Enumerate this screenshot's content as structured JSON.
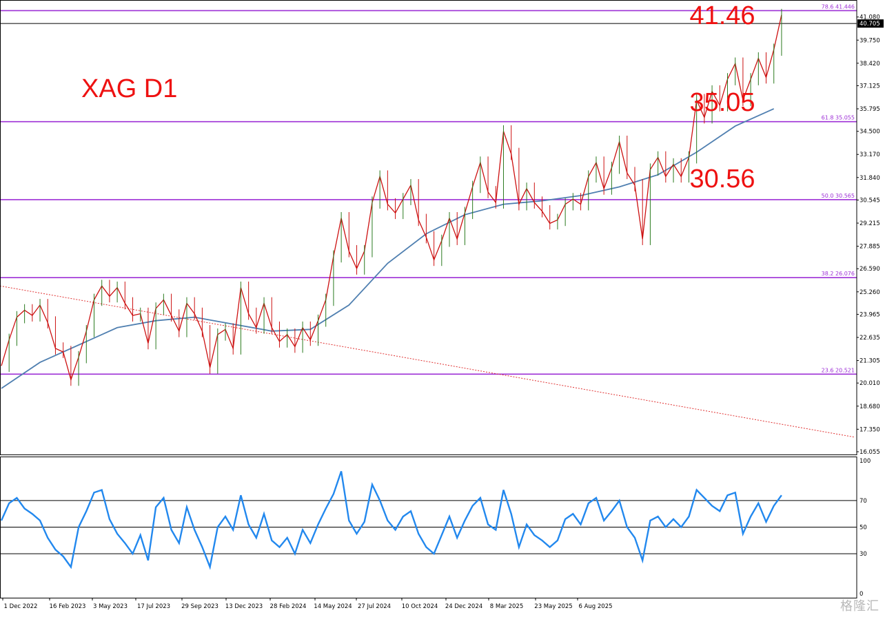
{
  "chart_data": {
    "type": "line",
    "symbol_label": "XAG D1",
    "price_axis": {
      "range": [
        16.055,
        41.98
      ],
      "tick_labels": [
        "41.080",
        "39.750",
        "38.420",
        "37.125",
        "35.795",
        "34.500",
        "33.170",
        "31.840",
        "30.545",
        "29.215",
        "27.885",
        "26.590",
        "25.260",
        "23.965",
        "22.635",
        "21.305",
        "20.010",
        "18.680",
        "17.350",
        "16.055"
      ],
      "current_price_label": "40.705",
      "current_price": 40.705
    },
    "x_axis": {
      "tick_labels": [
        "1 Dec 2022",
        "16 Feb 2023",
        "3 May 2023",
        "17 Jul 2023",
        "29 Sep 2023",
        "13 Dec 2023",
        "28 Feb 2024",
        "14 May 2024",
        "27 Jul 2024",
        "10 Oct 2024",
        "24 Dec 2024",
        "8 Mar 2025",
        "23 May 2025",
        "6 Aug 2025"
      ]
    },
    "fib_levels": [
      {
        "label": "78.6 41.446",
        "value": 41.446
      },
      {
        "label": "61.8 35.055",
        "value": 35.055
      },
      {
        "label": "50.0 30.565",
        "value": 30.565
      },
      {
        "label": "38.2 26.076",
        "value": 26.076
      },
      {
        "label": "23.6 20.521",
        "value": 20.521
      }
    ],
    "annotations": [
      {
        "text": "41.46",
        "anchor_price": 41.46
      },
      {
        "text": "35.05",
        "anchor_price": 35.05
      },
      {
        "text": "30.56",
        "anchor_price": 30.56
      }
    ],
    "trendline": {
      "style": "dotted",
      "color": "#e03030",
      "start_price": 25.6,
      "end_price": 16.9
    },
    "price_series_points": [
      [
        0,
        21.0
      ],
      [
        2,
        22.5
      ],
      [
        4,
        23.8
      ],
      [
        6,
        24.2
      ],
      [
        8,
        23.9
      ],
      [
        10,
        24.5
      ],
      [
        12,
        23.5
      ],
      [
        14,
        22.0
      ],
      [
        16,
        21.8
      ],
      [
        18,
        20.2
      ],
      [
        20,
        21.5
      ],
      [
        22,
        23.0
      ],
      [
        24,
        24.8
      ],
      [
        26,
        25.6
      ],
      [
        28,
        25.0
      ],
      [
        30,
        25.5
      ],
      [
        32,
        24.6
      ],
      [
        34,
        23.9
      ],
      [
        36,
        24.0
      ],
      [
        38,
        22.3
      ],
      [
        40,
        24.3
      ],
      [
        42,
        24.8
      ],
      [
        44,
        23.9
      ],
      [
        46,
        23.0
      ],
      [
        48,
        24.6
      ],
      [
        50,
        24.0
      ],
      [
        52,
        23.0
      ],
      [
        54,
        20.9
      ],
      [
        56,
        22.8
      ],
      [
        58,
        23.1
      ],
      [
        60,
        22.0
      ],
      [
        62,
        25.5
      ],
      [
        64,
        24.0
      ],
      [
        66,
        23.2
      ],
      [
        68,
        24.6
      ],
      [
        70,
        23.2
      ],
      [
        72,
        22.4
      ],
      [
        74,
        22.8
      ],
      [
        76,
        22.1
      ],
      [
        78,
        23.2
      ],
      [
        80,
        22.5
      ],
      [
        82,
        23.6
      ],
      [
        84,
        24.8
      ],
      [
        86,
        27.3
      ],
      [
        88,
        29.5
      ],
      [
        90,
        27.6
      ],
      [
        92,
        26.6
      ],
      [
        94,
        27.6
      ],
      [
        96,
        30.4
      ],
      [
        98,
        31.9
      ],
      [
        100,
        30.3
      ],
      [
        102,
        29.8
      ],
      [
        104,
        30.6
      ],
      [
        106,
        31.4
      ],
      [
        108,
        29.4
      ],
      [
        110,
        28.4
      ],
      [
        112,
        27.1
      ],
      [
        114,
        28.2
      ],
      [
        116,
        29.5
      ],
      [
        118,
        28.3
      ],
      [
        120,
        29.8
      ],
      [
        122,
        31.3
      ],
      [
        124,
        32.7
      ],
      [
        126,
        31.0
      ],
      [
        128,
        30.4
      ],
      [
        130,
        34.5
      ],
      [
        132,
        33.2
      ],
      [
        134,
        30.3
      ],
      [
        136,
        31.2
      ],
      [
        138,
        30.4
      ],
      [
        140,
        29.9
      ],
      [
        142,
        29.2
      ],
      [
        144,
        29.4
      ],
      [
        146,
        30.3
      ],
      [
        148,
        30.6
      ],
      [
        150,
        30.3
      ],
      [
        152,
        31.9
      ],
      [
        154,
        32.7
      ],
      [
        156,
        31.2
      ],
      [
        158,
        32.4
      ],
      [
        160,
        33.9
      ],
      [
        162,
        32.1
      ],
      [
        164,
        31.4
      ],
      [
        166,
        28.3
      ],
      [
        168,
        32.3
      ],
      [
        170,
        33.0
      ],
      [
        172,
        31.9
      ],
      [
        174,
        32.6
      ],
      [
        176,
        31.9
      ],
      [
        178,
        33.0
      ],
      [
        180,
        36.3
      ],
      [
        182,
        35.3
      ],
      [
        184,
        36.8
      ],
      [
        186,
        36.0
      ],
      [
        188,
        37.5
      ],
      [
        190,
        38.4
      ],
      [
        192,
        36.3
      ],
      [
        194,
        37.5
      ],
      [
        196,
        38.7
      ],
      [
        198,
        37.6
      ],
      [
        200,
        39.2
      ],
      [
        202,
        41.2
      ]
    ],
    "ma_series_points": [
      [
        0,
        19.7
      ],
      [
        10,
        21.2
      ],
      [
        20,
        22.2
      ],
      [
        30,
        23.2
      ],
      [
        40,
        23.6
      ],
      [
        50,
        23.8
      ],
      [
        60,
        23.4
      ],
      [
        70,
        23.0
      ],
      [
        80,
        23.1
      ],
      [
        90,
        24.5
      ],
      [
        100,
        26.9
      ],
      [
        110,
        28.6
      ],
      [
        120,
        29.7
      ],
      [
        130,
        30.3
      ],
      [
        140,
        30.5
      ],
      [
        150,
        30.8
      ],
      [
        160,
        31.3
      ],
      [
        170,
        32.0
      ],
      [
        180,
        33.3
      ],
      [
        190,
        34.8
      ],
      [
        200,
        35.8
      ]
    ],
    "rsi": {
      "range": [
        0,
        100
      ],
      "levels": [
        {
          "label": "70",
          "value": 70
        },
        {
          "label": "50",
          "value": 50
        },
        {
          "label": "30",
          "value": 30
        }
      ],
      "axis_labels": [
        "100",
        "70",
        "50",
        "30",
        "0"
      ],
      "points": [
        [
          0,
          55
        ],
        [
          2,
          68
        ],
        [
          4,
          72
        ],
        [
          6,
          64
        ],
        [
          8,
          60
        ],
        [
          10,
          55
        ],
        [
          12,
          42
        ],
        [
          14,
          33
        ],
        [
          16,
          28
        ],
        [
          18,
          20
        ],
        [
          20,
          50
        ],
        [
          22,
          62
        ],
        [
          24,
          76
        ],
        [
          26,
          78
        ],
        [
          28,
          56
        ],
        [
          30,
          45
        ],
        [
          32,
          38
        ],
        [
          34,
          30
        ],
        [
          36,
          44
        ],
        [
          38,
          25
        ],
        [
          40,
          65
        ],
        [
          42,
          72
        ],
        [
          44,
          48
        ],
        [
          46,
          38
        ],
        [
          48,
          65
        ],
        [
          50,
          48
        ],
        [
          52,
          35
        ],
        [
          54,
          20
        ],
        [
          56,
          50
        ],
        [
          58,
          58
        ],
        [
          60,
          48
        ],
        [
          62,
          74
        ],
        [
          64,
          52
        ],
        [
          66,
          42
        ],
        [
          68,
          60
        ],
        [
          70,
          40
        ],
        [
          72,
          35
        ],
        [
          74,
          42
        ],
        [
          76,
          30
        ],
        [
          78,
          48
        ],
        [
          80,
          38
        ],
        [
          82,
          52
        ],
        [
          84,
          64
        ],
        [
          86,
          75
        ],
        [
          88,
          92
        ],
        [
          90,
          55
        ],
        [
          92,
          45
        ],
        [
          94,
          54
        ],
        [
          96,
          82
        ],
        [
          98,
          70
        ],
        [
          100,
          55
        ],
        [
          102,
          48
        ],
        [
          104,
          58
        ],
        [
          106,
          62
        ],
        [
          108,
          45
        ],
        [
          110,
          35
        ],
        [
          112,
          30
        ],
        [
          114,
          44
        ],
        [
          116,
          58
        ],
        [
          118,
          42
        ],
        [
          120,
          55
        ],
        [
          122,
          66
        ],
        [
          124,
          72
        ],
        [
          126,
          52
        ],
        [
          128,
          48
        ],
        [
          130,
          78
        ],
        [
          132,
          60
        ],
        [
          134,
          35
        ],
        [
          136,
          52
        ],
        [
          138,
          44
        ],
        [
          140,
          40
        ],
        [
          142,
          35
        ],
        [
          144,
          40
        ],
        [
          146,
          56
        ],
        [
          148,
          60
        ],
        [
          150,
          52
        ],
        [
          152,
          68
        ],
        [
          154,
          72
        ],
        [
          156,
          55
        ],
        [
          158,
          62
        ],
        [
          160,
          70
        ],
        [
          162,
          50
        ],
        [
          164,
          42
        ],
        [
          166,
          25
        ],
        [
          168,
          55
        ],
        [
          170,
          58
        ],
        [
          172,
          50
        ],
        [
          174,
          56
        ],
        [
          176,
          50
        ],
        [
          178,
          58
        ],
        [
          180,
          78
        ],
        [
          182,
          72
        ],
        [
          184,
          66
        ],
        [
          186,
          62
        ],
        [
          188,
          74
        ],
        [
          190,
          76
        ],
        [
          192,
          45
        ],
        [
          194,
          58
        ],
        [
          196,
          68
        ],
        [
          198,
          54
        ],
        [
          200,
          66
        ],
        [
          202,
          74
        ]
      ]
    },
    "colors": {
      "price": "#cc1010",
      "price_alt": "#2a7a1e",
      "ma": "#4f7fb0",
      "fib": "#9d2fd6",
      "rsi": "#2288ee",
      "annotation": "#ee1111",
      "grid_line": "#000000"
    }
  },
  "watermark": {
    "text": "格隆汇"
  }
}
